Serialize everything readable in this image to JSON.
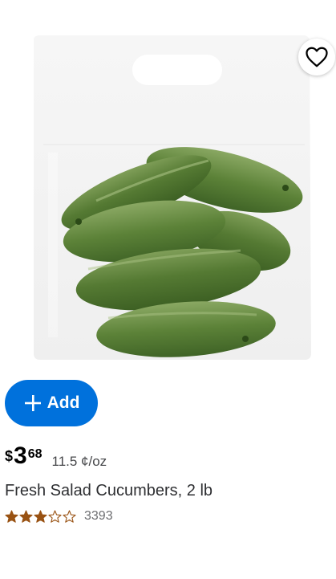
{
  "product": {
    "image_icon": "cucumber-bag-image",
    "favorite_icon": "heart-outline-icon",
    "add_label": "Add",
    "add_icon": "plus-icon",
    "price_symbol": "$",
    "price_whole": "3",
    "price_cents": "68",
    "unit_price": "11.5 ¢/oz",
    "title": "Fresh Salad Cucumbers, 2 lb",
    "rating": 3,
    "rating_max": 5,
    "review_count": "3393"
  },
  "colors": {
    "accent": "#0071dc",
    "star": "#995213",
    "text": "#2e2f32"
  }
}
